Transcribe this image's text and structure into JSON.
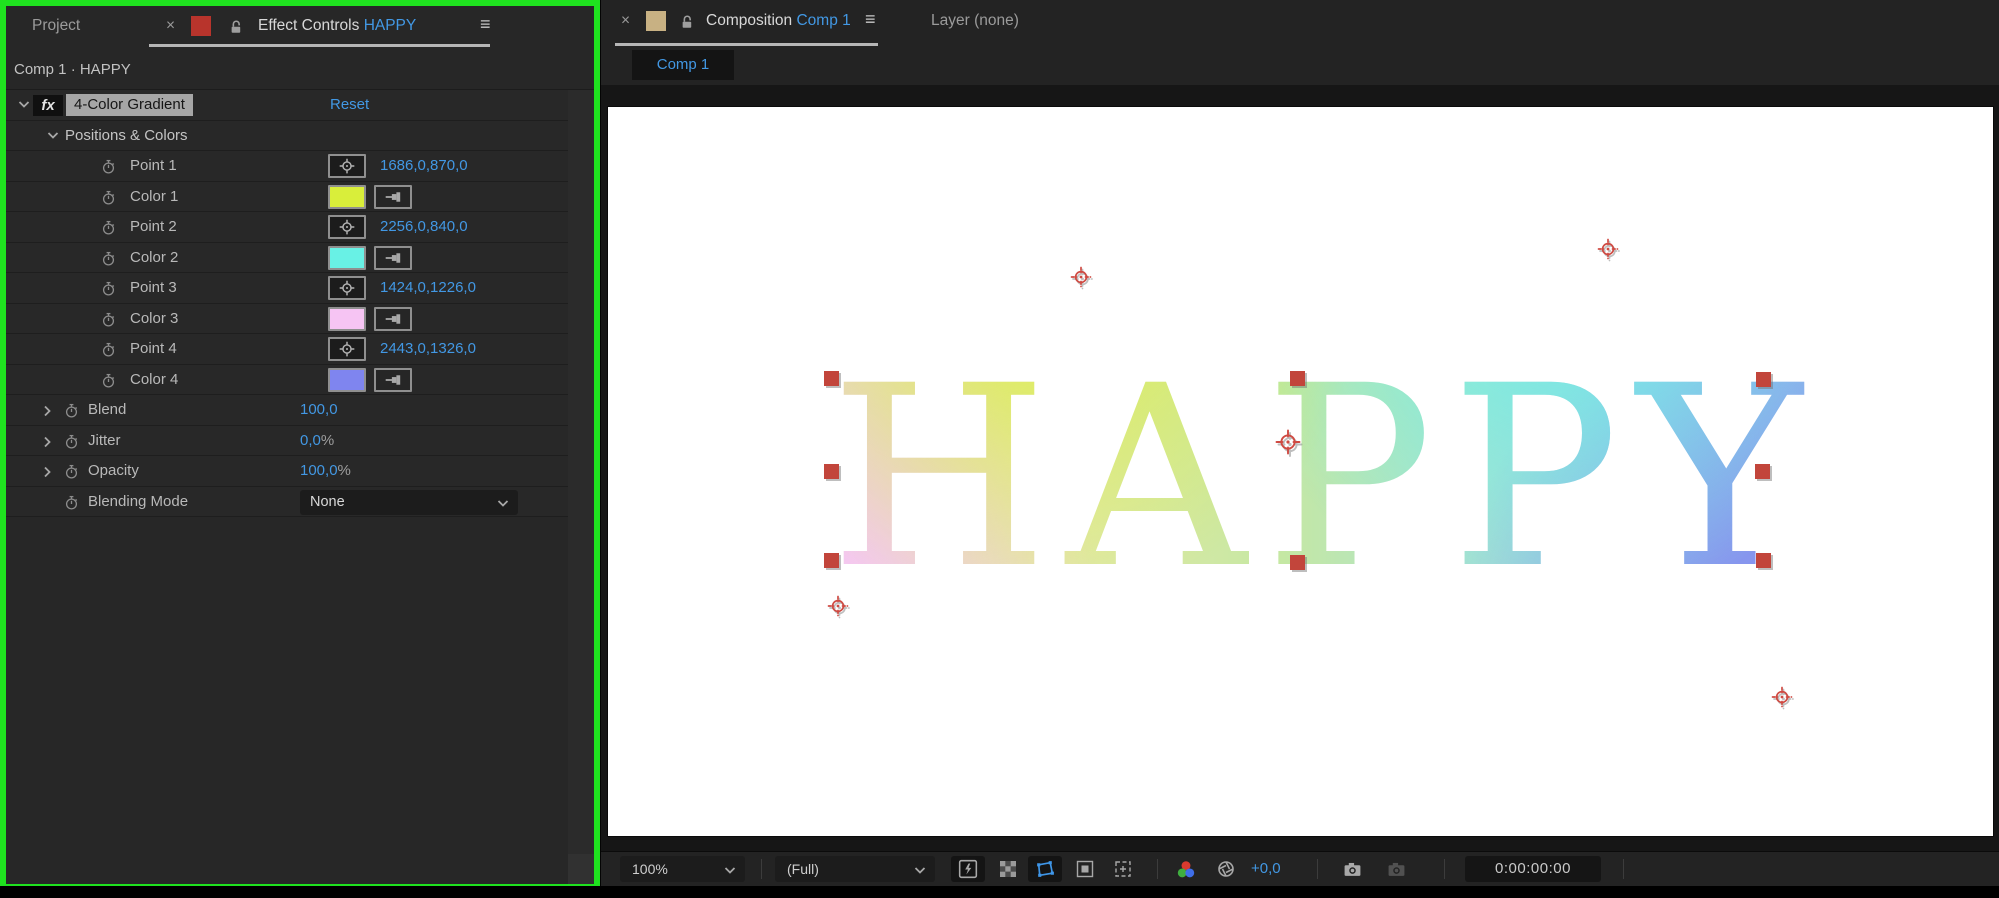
{
  "colors": {
    "accent_blue": "#4298e4",
    "focus_green": "#1fe21f",
    "effect_tab_label_color": "#b8342c",
    "comp_tab_label_color": "#c8b183",
    "handle_red": "#c2453b"
  },
  "effect_panel": {
    "tab_project": "Project",
    "tab_close": "×",
    "tab_title": "Effect Controls",
    "tab_target": "HAPPY",
    "menu_glyph": "≡",
    "subtitle": "Comp 1 · HAPPY",
    "fx_badge": "fx",
    "effect_name": "4-Color Gradient",
    "reset_label": "Reset",
    "group_label": "Positions & Colors",
    "rows": [
      {
        "label": "Point 1",
        "value": "1686,0,870,0"
      },
      {
        "label": "Color 1",
        "color": "#d9ee3a"
      },
      {
        "label": "Point 2",
        "value": "2256,0,840,0"
      },
      {
        "label": "Color 2",
        "color": "#68f1e5"
      },
      {
        "label": "Point 3",
        "value": "1424,0,1226,0"
      },
      {
        "label": "Color 3",
        "color": "#f6c4f3"
      },
      {
        "label": "Point 4",
        "value": "2443,0,1326,0"
      },
      {
        "label": "Color 4",
        "color": "#7f85ef"
      }
    ],
    "params": [
      {
        "label": "Blend",
        "value": "100,0",
        "suffix": ""
      },
      {
        "label": "Jitter",
        "value": "0,0",
        "suffix": "%"
      },
      {
        "label": "Opacity",
        "value": "100,0",
        "suffix": "%"
      }
    ],
    "blending_mode": {
      "label": "Blending Mode",
      "value": "None"
    }
  },
  "comp_panel": {
    "tab_close": "×",
    "tab_title": "Composition",
    "tab_target": "Comp 1",
    "menu_glyph": "≡",
    "tab_layer": "Layer (none)",
    "breadcrumb": "Comp 1",
    "canvas_text": "HAPPY",
    "toolbar": {
      "zoom": "100%",
      "resolution": "(Full)",
      "exposure": "+0,0",
      "timecode": "0:00:00:00"
    }
  }
}
